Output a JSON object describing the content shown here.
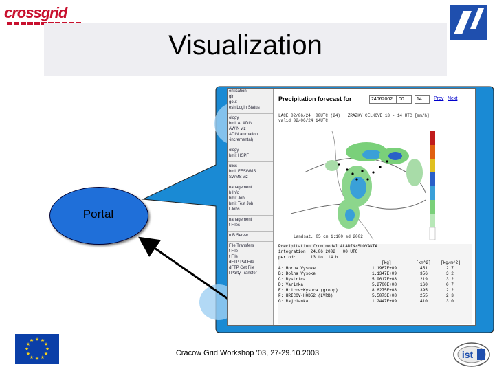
{
  "header": {
    "logo_text": "crossgrid",
    "title": "Visualization"
  },
  "diagram": {
    "portal_label": "Portal"
  },
  "screenshot": {
    "nav_items": [
      "entication",
      "gin",
      "gout",
      "esh Login Status",
      "",
      "ology",
      "bmit ALADIN",
      "AWIN viz",
      "ADIN animation",
      "-incremental)",
      "",
      "ology",
      "bmit HSPF",
      "",
      "ulics",
      "bmit FESWMS",
      "SWMS viz",
      "",
      "nanagement",
      "b Info",
      "bmit Job",
      "bmit Test Job",
      "l Jobs",
      "",
      "nanagement",
      "t Files",
      "",
      "n B Server",
      "",
      "File Transfers",
      "t File",
      "t File",
      "dFTP Put File",
      "dFTP Get File",
      "l Party Transfer"
    ],
    "heading": "Precipitation forecast for",
    "date_value": "24062002",
    "hour_value": "00",
    "step_value": "14",
    "link_prev": "Prev",
    "link_next": "Next",
    "map_info_line1": "LACE 02/06/24  00UTC (24)   ZRAZKY CELKOVE 13 - 14 UTC [mm/h]",
    "map_info_line2": "valid 02/06/24 14UTC",
    "map_caption": "Landsat, 05 cm 1:100 sd 2002",
    "table_title": "Precipitation from model ALADIN/SLOVAKIA",
    "table_integration": "integration: 24.06.2002   00 UTC",
    "table_period": "period:      13 to  14 h",
    "table_columns": [
      "[kg]",
      "[km^2]",
      "[kg/m^2]"
    ],
    "table_rows": [
      {
        "name": "A: Horna Vysoke",
        "kg": "1.1967E+09",
        "km2": "451",
        "kgm2": "2.7"
      },
      {
        "name": "B: Dolna Vysoke",
        "kg": "1.1347E+09",
        "km2": "356",
        "kgm2": "3.2"
      },
      {
        "name": "C: Bystrica",
        "kg": "5.9617E+08",
        "km2": "219",
        "kgm2": "3.2"
      },
      {
        "name": "D: Varinka",
        "kg": "5.2700E+08",
        "km2": "160",
        "kgm2": "0.7"
      },
      {
        "name": "E: Hricov+Kysuca (group)",
        "kg": "8.6275E+08",
        "km2": "395",
        "kgm2": "2.2"
      },
      {
        "name": "F: HRICOV-HOD52 (LVRB)",
        "kg": "5.5073E+08",
        "km2": "255",
        "kgm2": "2.3"
      },
      {
        "name": "G: Rajcianka",
        "kg": "1.2447E+09",
        "km2": "410",
        "kgm2": "3.0"
      }
    ]
  },
  "footer": {
    "text": "Cracow Grid Workshop ’03, 27-29.10.2003",
    "ist_logo_text": "ist"
  },
  "colors": {
    "portal_fill": "#1f6fd9",
    "callout_fill": "#1a8ad4",
    "title_band": "#eeeef2"
  }
}
